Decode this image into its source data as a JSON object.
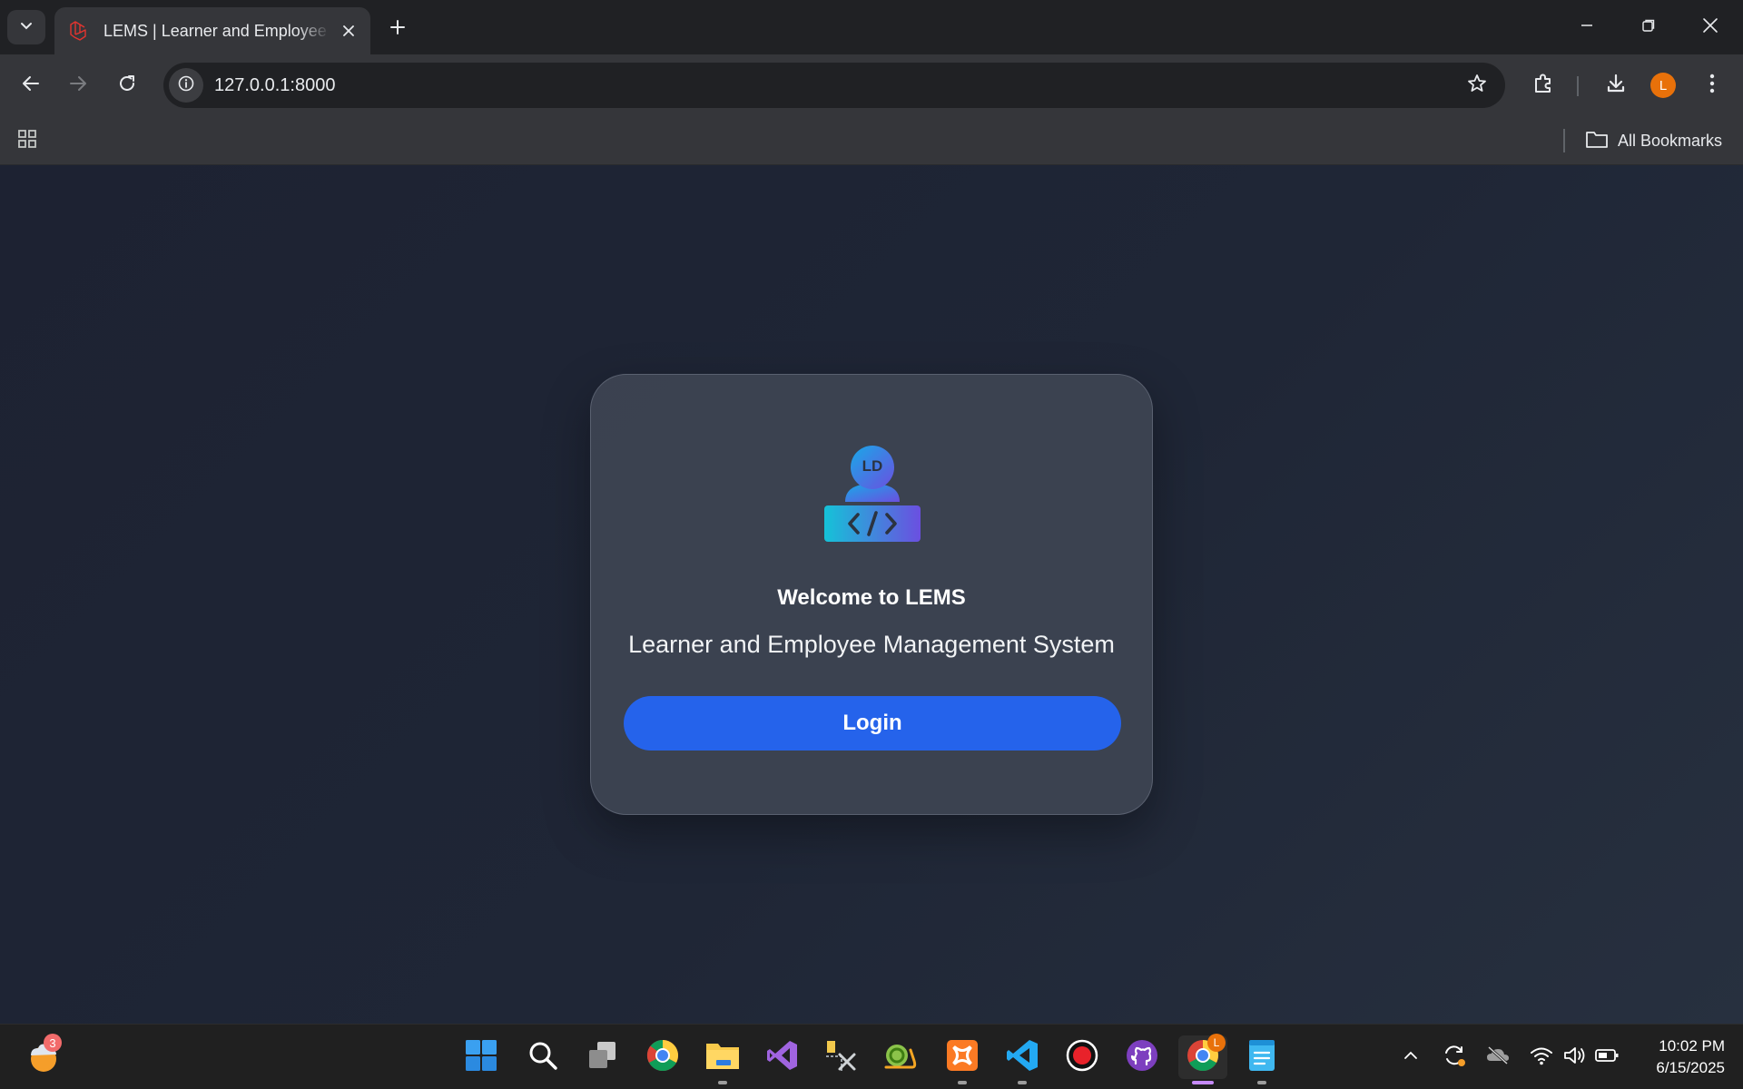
{
  "browser": {
    "tab": {
      "title": "LEMS | Learner and Employee Management System"
    },
    "url": "127.0.0.1:8000",
    "bookmarks": {
      "all_label": "All Bookmarks"
    },
    "profile_initial": "L"
  },
  "page": {
    "logo": {
      "initials": "LD"
    },
    "welcome": "Welcome to LEMS",
    "subtitle": "Learner and Employee Management System",
    "login_label": "Login"
  },
  "taskbar": {
    "weather_badge": "3",
    "chrome_badge": "L",
    "clock": {
      "time": "10:02 PM",
      "date": "6/15/2025"
    }
  },
  "colors": {
    "accent_button": "#2563eb",
    "profile": "#e8710a",
    "page_bg": "#1f2636",
    "card_bg": "#3e4452"
  }
}
